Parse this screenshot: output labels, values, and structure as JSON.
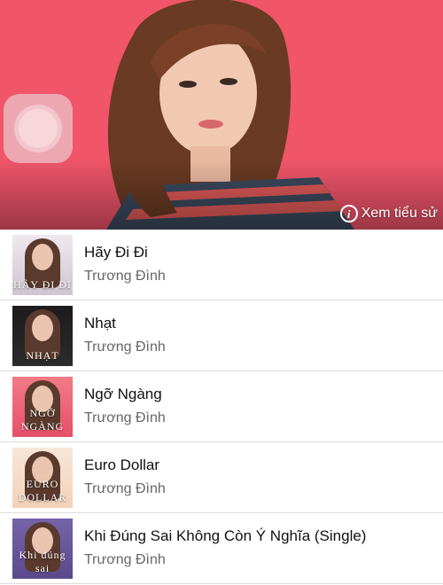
{
  "hero": {
    "bio_link_label": "Xem tiểu sử",
    "accent_color": "#f0556a"
  },
  "songs": [
    {
      "title": "Hãy Đi Đi",
      "artist": "Trương Đình",
      "cover_text": "HÃY ĐI ĐI"
    },
    {
      "title": "Nhạt",
      "artist": "Trương Đình",
      "cover_text": "NHẠT"
    },
    {
      "title": "Ngỡ Ngàng",
      "artist": "Trương Đình",
      "cover_text": "NGỠ NGÀNG"
    },
    {
      "title": "Euro Dollar",
      "artist": "Trương Đình",
      "cover_text": "EURO DOLLAR"
    },
    {
      "title": "Khi Đúng Sai Không Còn Ý Nghĩa (Single)",
      "artist": "Trương Đình",
      "cover_text": "Khi đúng sai"
    }
  ]
}
